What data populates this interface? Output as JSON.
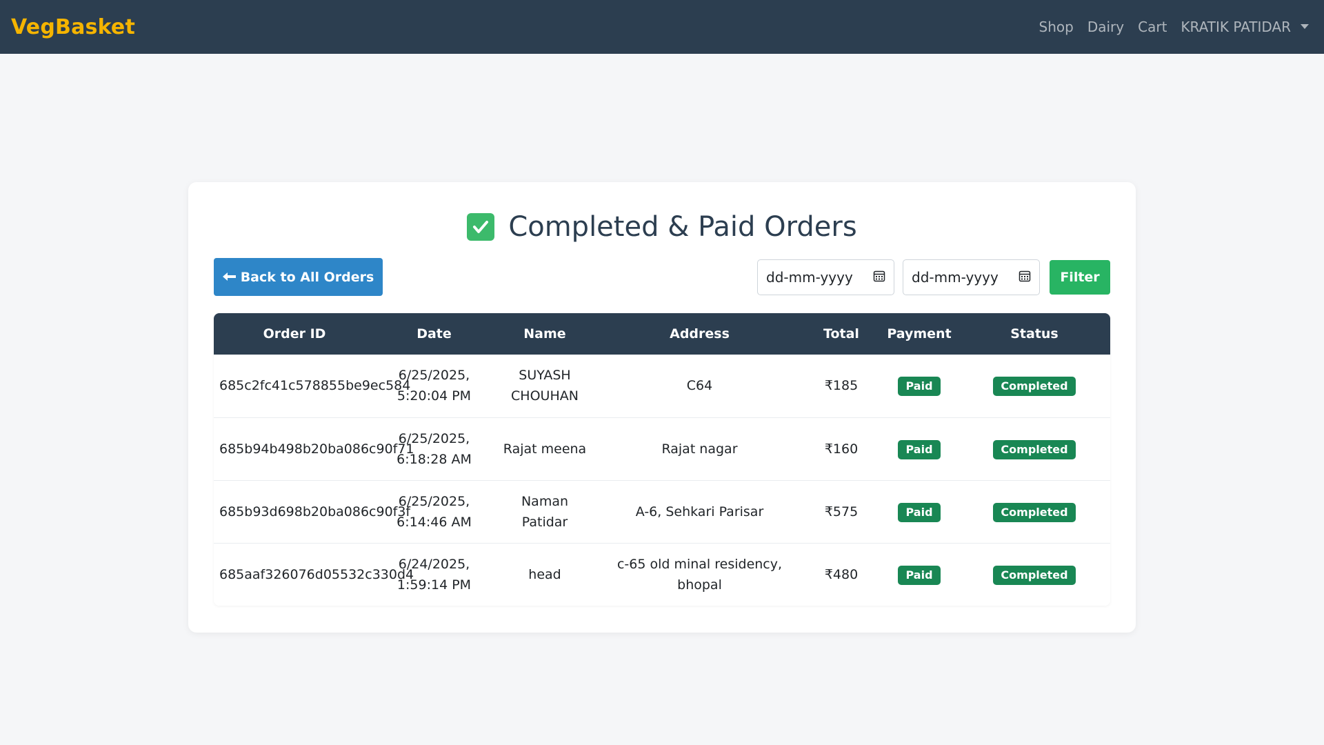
{
  "navbar": {
    "brand": "VegBasket",
    "links": [
      "Shop",
      "Dairy",
      "Cart"
    ],
    "user": "KRATIK PATIDAR"
  },
  "page": {
    "title": "Completed & Paid Orders",
    "back_button": "Back to All Orders",
    "date_from_placeholder": "dd-mm-yyyy",
    "date_to_placeholder": "dd-mm-yyyy",
    "filter_button": "Filter"
  },
  "table": {
    "headers": [
      "Order ID",
      "Date",
      "Name",
      "Address",
      "Total",
      "Payment",
      "Status"
    ],
    "rows": [
      {
        "order_id": "685c2fc41c578855be9ec584",
        "date": "6/25/2025, 5:20:04 PM",
        "name": "SUYASH CHOUHAN",
        "address": "C64",
        "total": "₹185",
        "payment": "Paid",
        "status": "Completed"
      },
      {
        "order_id": "685b94b498b20ba086c90f71",
        "date": "6/25/2025, 6:18:28 AM",
        "name": "Rajat meena",
        "address": "Rajat nagar",
        "total": "₹160",
        "payment": "Paid",
        "status": "Completed"
      },
      {
        "order_id": "685b93d698b20ba086c90f3f",
        "date": "6/25/2025, 6:14:46 AM",
        "name": "Naman Patidar",
        "address": "A-6, Sehkari Parisar",
        "total": "₹575",
        "payment": "Paid",
        "status": "Completed"
      },
      {
        "order_id": "685aaf326076d05532c330d4",
        "date": "6/24/2025, 1:59:14 PM",
        "name": "head",
        "address": "c-65 old minal residency, bhopal",
        "total": "₹480",
        "payment": "Paid",
        "status": "Completed"
      }
    ]
  },
  "colors": {
    "navbar_bg": "#2c3e50",
    "brand": "#f5b400",
    "back_button": "#2e86c8",
    "filter_button": "#28b463",
    "badge": "#198754"
  },
  "icons": {
    "title_icon": "check-mark-button-icon",
    "back_arrow": "left-arrow-icon",
    "calendar": "calendar-icon",
    "user_caret": "caret-down-icon"
  }
}
